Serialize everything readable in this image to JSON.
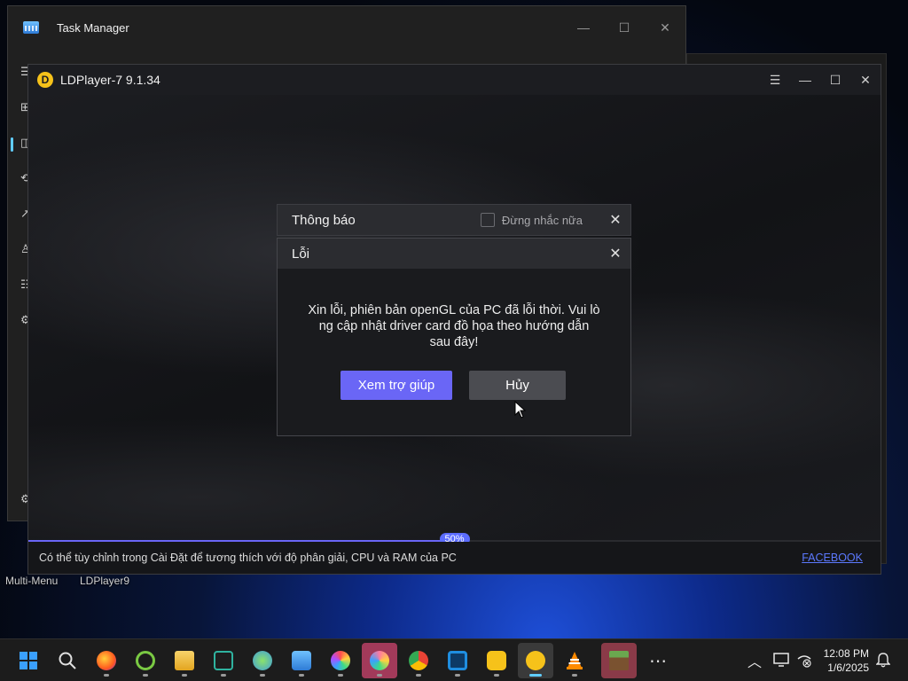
{
  "task_manager": {
    "title": "Task Manager",
    "controls": {
      "minimize": "—",
      "maximize": "☐",
      "close": "✕"
    },
    "sidebar_glyphs": [
      "☰",
      "⊞",
      "◫",
      "⟲",
      "↗",
      "♙",
      "☷",
      "⚙",
      "⚙"
    ]
  },
  "desktop": {
    "label_1": "Multi-Menu",
    "label_2": "LDPlayer9"
  },
  "ldplayer": {
    "title": "LDPlayer-7 9.1.34",
    "logo_glyph": "D",
    "controls": {
      "menu": "☰",
      "minimize": "—",
      "maximize": "☐",
      "close": "✕"
    },
    "progress": {
      "percent": 50,
      "label": "50%"
    },
    "footer_tip": "Có thể tùy chỉnh trong Cài Đặt để tương thích với độ phân giải, CPU và RAM của PC",
    "footer_link": "FACEBOOK",
    "accent": "#6a66f6"
  },
  "notice_dialog": {
    "title": "Thông báo",
    "checkbox_label": "Đừng nhắc nữa",
    "checked": false,
    "close": "✕"
  },
  "error_dialog": {
    "title": "Lỗi",
    "close": "✕",
    "message_line_1": "Xin lỗi, phiên bản openGL của PC đã lỗi thời. Vui lò",
    "message_line_2": "ng cập nhật driver card đồ họa theo hướng dẫn",
    "message_line_3": "sau đây!",
    "help_button": "Xem trợ giúp",
    "cancel_button": "Hủy"
  },
  "taskbar": {
    "apps": [
      {
        "name": "start",
        "color": "#3aa0ff"
      },
      {
        "name": "search",
        "color": "#e0e0e0"
      },
      {
        "name": "firefox",
        "color": "#ff7a1a"
      },
      {
        "name": "optimizer",
        "color": "#7ac943"
      },
      {
        "name": "file-explorer",
        "color": "#f5c542"
      },
      {
        "name": "visual-studio",
        "color": "#2fb3a0"
      },
      {
        "name": "network",
        "color": "#3f9ddc"
      },
      {
        "name": "task-manager",
        "color": "#5bb0ff"
      },
      {
        "name": "paint",
        "color": "#e83e8c"
      },
      {
        "name": "paint-active",
        "color": "#e06a9a"
      },
      {
        "name": "chrome",
        "color": "#34a853"
      },
      {
        "name": "virtualbox",
        "color": "#1f8ee0"
      },
      {
        "name": "ldmulti",
        "color": "#f6c21a"
      },
      {
        "name": "ldplayer",
        "color": "#f6c21a"
      },
      {
        "name": "vlc",
        "color": "#ff8a00"
      },
      {
        "name": "minecraft",
        "color": "#6b8e3d"
      },
      {
        "name": "more",
        "color": "#e0e0e0"
      }
    ],
    "more_glyph": "⋯",
    "tray_chevron": "︿",
    "clock_time": "12:08 PM",
    "clock_date": "1/6/2025",
    "bell": "🔔"
  }
}
